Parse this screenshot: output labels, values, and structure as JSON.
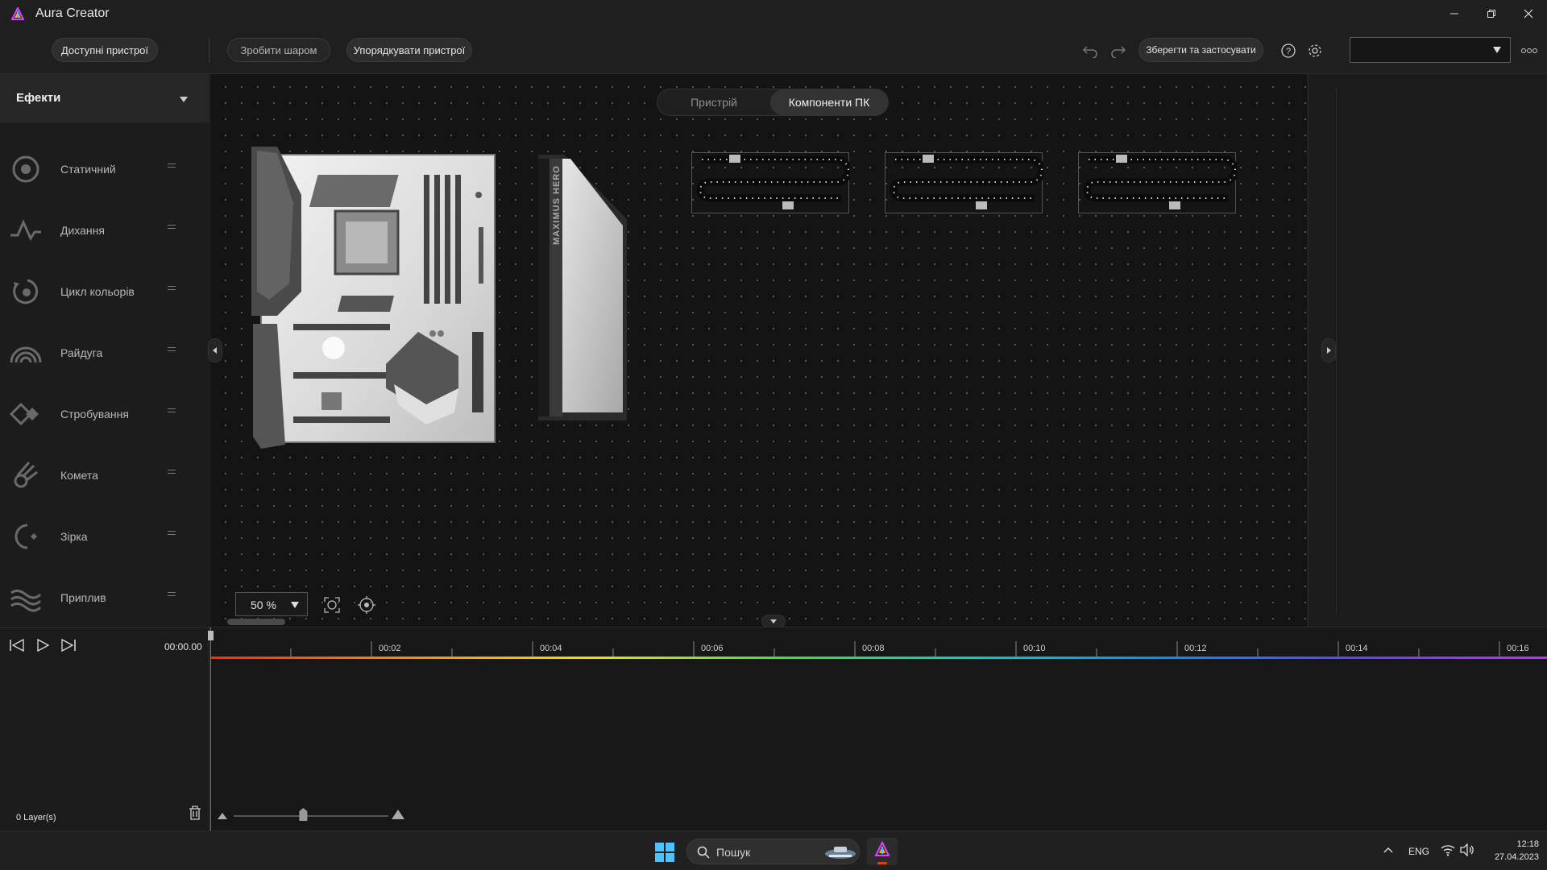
{
  "window": {
    "title": "Aura Creator"
  },
  "toolbar": {
    "available_devices": "Доступні пристрої",
    "make_layer": "Зробити шаром",
    "arrange_devices": "Упорядкувати пристрої",
    "save_apply": "Зберегти та застосувати",
    "profile_value": ""
  },
  "sidebar": {
    "title": "Ефекти",
    "effects": [
      {
        "label": "Статичний",
        "icon": "static-icon"
      },
      {
        "label": "Дихання",
        "icon": "breathing-icon"
      },
      {
        "label": "Цикл кольорів",
        "icon": "color-cycle-icon"
      },
      {
        "label": "Райдуга",
        "icon": "rainbow-icon"
      },
      {
        "label": "Стробування",
        "icon": "strobe-icon"
      },
      {
        "label": "Комета",
        "icon": "comet-icon"
      },
      {
        "label": "Зірка",
        "icon": "star-icon"
      },
      {
        "label": "Приплив",
        "icon": "tide-icon"
      }
    ]
  },
  "canvas": {
    "tabs": {
      "device": "Пристрій",
      "pc_components": "Компоненти ПК",
      "active": "pc_components"
    },
    "zoom": "50 %",
    "gpu_text": "MAXIMUS HERO"
  },
  "timeline": {
    "current_time": "00:00.00",
    "layers": "0  Layer(s)",
    "ticks": [
      "00:02",
      "00:04",
      "00:06",
      "00:08",
      "00:10",
      "00:12",
      "00:14",
      "00:16"
    ],
    "zoom_level": 0.45
  },
  "taskbar": {
    "search_placeholder": "Пошук",
    "language": "ENG",
    "time": "12:18",
    "date": "27.04.2023"
  },
  "colors": {
    "aura_accent": "#d9401c",
    "background": "#1b1b1b",
    "canvas": "#141414"
  }
}
